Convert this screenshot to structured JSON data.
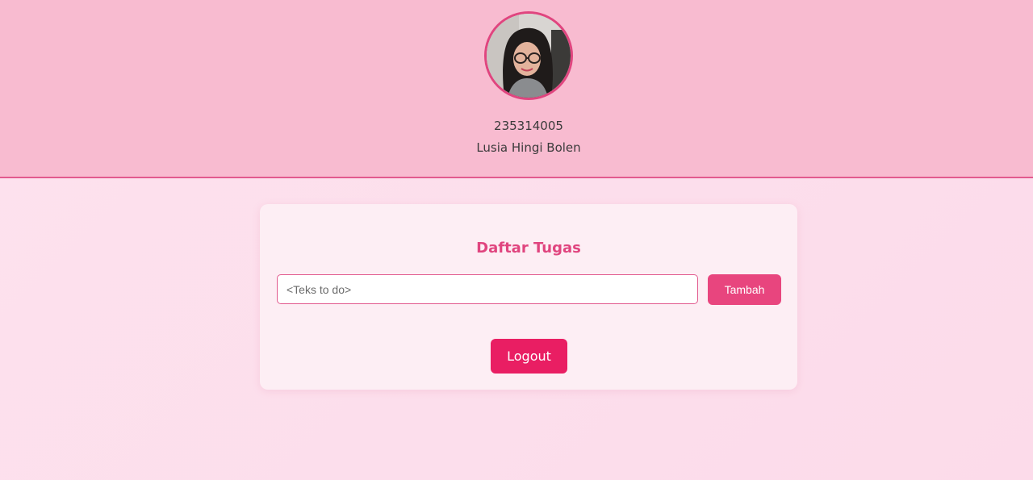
{
  "profile": {
    "avatar_alt": "profile photo",
    "nim": "235314005",
    "name": "Lusia Hingi Bolen"
  },
  "todo": {
    "title": "Daftar Tugas",
    "input_placeholder": "<Teks to do>",
    "input_value": "",
    "add_label": "Tambah"
  },
  "logout_label": "Logout",
  "colors": {
    "header_bg": "#f8bbd0",
    "accent": "#e0457f",
    "add_button": "#e8457e",
    "logout_button": "#e91e63",
    "card_bg": "#fdeef4",
    "page_bg": "#fde2ee"
  }
}
